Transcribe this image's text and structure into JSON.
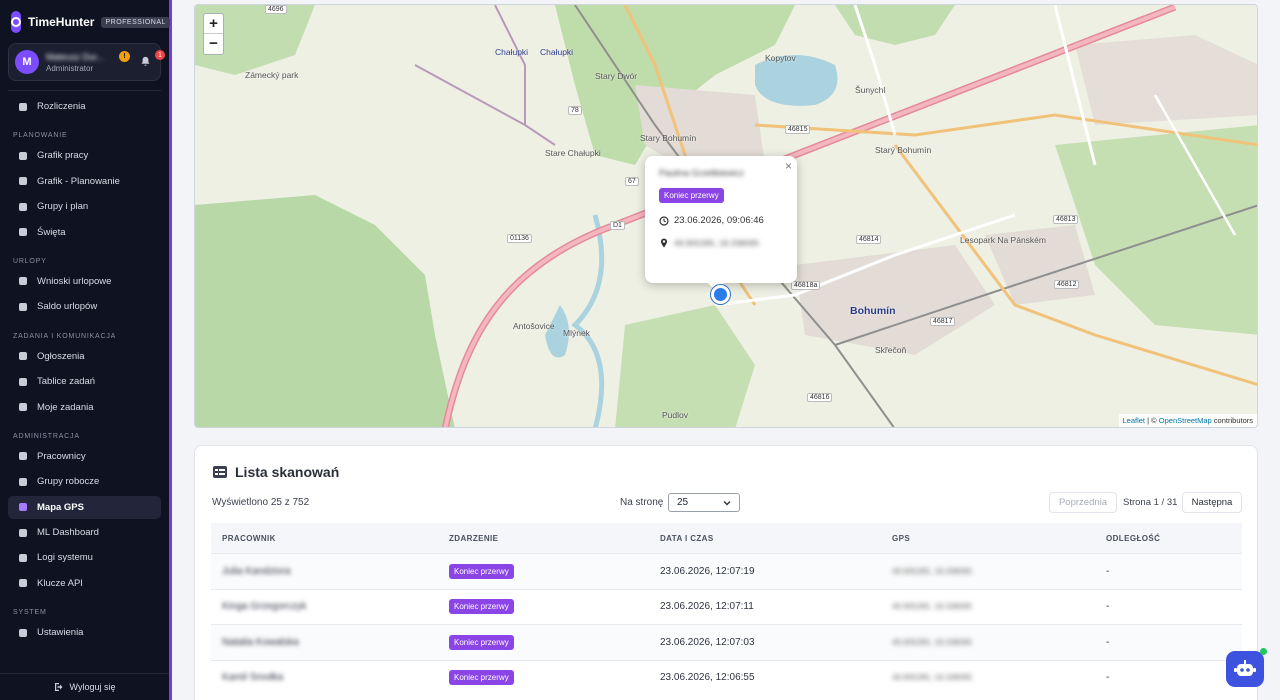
{
  "brand": {
    "name": "TimeHunter",
    "badge": "PROFESSIONAL"
  },
  "user": {
    "initial": "M",
    "name": "Mateusz Dur...",
    "role": "Administrator",
    "badge_count": "!",
    "notifications": "1"
  },
  "nav": {
    "items_top": [
      {
        "label": "Rozliczenia",
        "icon": "wallet-icon"
      }
    ],
    "sections": [
      {
        "title": "PLANOWANIE",
        "items": [
          {
            "label": "Grafik pracy",
            "icon": "calendar-icon"
          },
          {
            "label": "Grafik - Planowanie",
            "icon": "calendar-edit-icon"
          },
          {
            "label": "Grupy i plan",
            "icon": "sitemap-icon"
          },
          {
            "label": "Święta",
            "icon": "calendar-day-icon"
          }
        ]
      },
      {
        "title": "URLOPY",
        "items": [
          {
            "label": "Wnioski urlopowe",
            "icon": "document-icon"
          },
          {
            "label": "Saldo urlopów",
            "icon": "document-balance-icon"
          }
        ]
      },
      {
        "title": "ZADANIA I KOMUNIKACJA",
        "items": [
          {
            "label": "Ogłoszenia",
            "icon": "megaphone-icon"
          },
          {
            "label": "Tablice zadań",
            "icon": "board-icon"
          },
          {
            "label": "Moje zadania",
            "icon": "check-circle-icon"
          }
        ]
      },
      {
        "title": "ADMINISTRACJA",
        "items": [
          {
            "label": "Pracownicy",
            "icon": "users-icon"
          },
          {
            "label": "Grupy robocze",
            "icon": "layers-icon"
          },
          {
            "label": "Mapa GPS",
            "icon": "map-pin-icon",
            "active": true
          },
          {
            "label": "ML Dashboard",
            "icon": "chip-icon"
          },
          {
            "label": "Logi systemu",
            "icon": "log-icon"
          },
          {
            "label": "Klucze API",
            "icon": "key-icon"
          }
        ]
      },
      {
        "title": "SYSTEM",
        "items": [
          {
            "label": "Ustawienia",
            "icon": "gear-icon"
          }
        ]
      }
    ],
    "logout": "Wyloguj się"
  },
  "map": {
    "labels": [
      "Chałupki",
      "Chałupki",
      "Zámecký park",
      "Stary Dwór",
      "Stary Bohumín",
      "Kopytov",
      "Šunychl",
      "Starý Bohumín",
      "Bohumín",
      "Skřečoň",
      "Pudlov",
      "Antošovice",
      "Stare Chałupki",
      "Mlýnek",
      "Lesopark Na Pánském"
    ],
    "road_numbers": [
      "4696",
      "78",
      "67",
      "D1",
      "01136",
      "46815",
      "46814",
      "46813",
      "46812",
      "46817",
      "46816",
      "46818a"
    ],
    "zoom_in": "+",
    "zoom_out": "−",
    "popup": {
      "name": "Paulina Grzelikiewicz",
      "event": "Koniec przerwy",
      "datetime": "23.06.2026, 09:06:46",
      "gps": "49.905285, 18.338095",
      "close": "×"
    },
    "attribution": {
      "leaflet": "Leaflet",
      "sep": " | © ",
      "osm": "OpenStreetMap",
      "rest": " contributors"
    }
  },
  "list": {
    "title": "Lista skanowań",
    "shown": "Wyświetlono 25 z 752",
    "per_page_label": "Na stronę",
    "per_page_value": "25",
    "prev": "Poprzednia",
    "page_info": "Strona 1 / 31",
    "next": "Następna",
    "columns": [
      "PRACOWNIK",
      "ZDARZENIE",
      "DATA I CZAS",
      "GPS",
      "ODLEGŁOŚĆ"
    ],
    "rows": [
      {
        "employee": "Julia Kandziora",
        "event": "Koniec przerwy",
        "datetime": "23.06.2026, 12:07:19",
        "gps": "49.905285, 18.338095",
        "distance": "-"
      },
      {
        "employee": "Kinga Grzegorczyk",
        "event": "Koniec przerwy",
        "datetime": "23.06.2026, 12:07:11",
        "gps": "49.905285, 18.338095",
        "distance": "-"
      },
      {
        "employee": "Natalia Kowalska",
        "event": "Koniec przerwy",
        "datetime": "23.06.2026, 12:07:03",
        "gps": "49.905285, 18.338095",
        "distance": "-"
      },
      {
        "employee": "Kamil Smołka",
        "event": "Koniec przerwy",
        "datetime": "23.06.2026, 12:06:55",
        "gps": "49.905285, 18.338095",
        "distance": "-"
      }
    ]
  },
  "colors": {
    "accent": "#7c4dff",
    "event_badge": "#8b45e6",
    "sidebar_bg": "#0f1220"
  }
}
